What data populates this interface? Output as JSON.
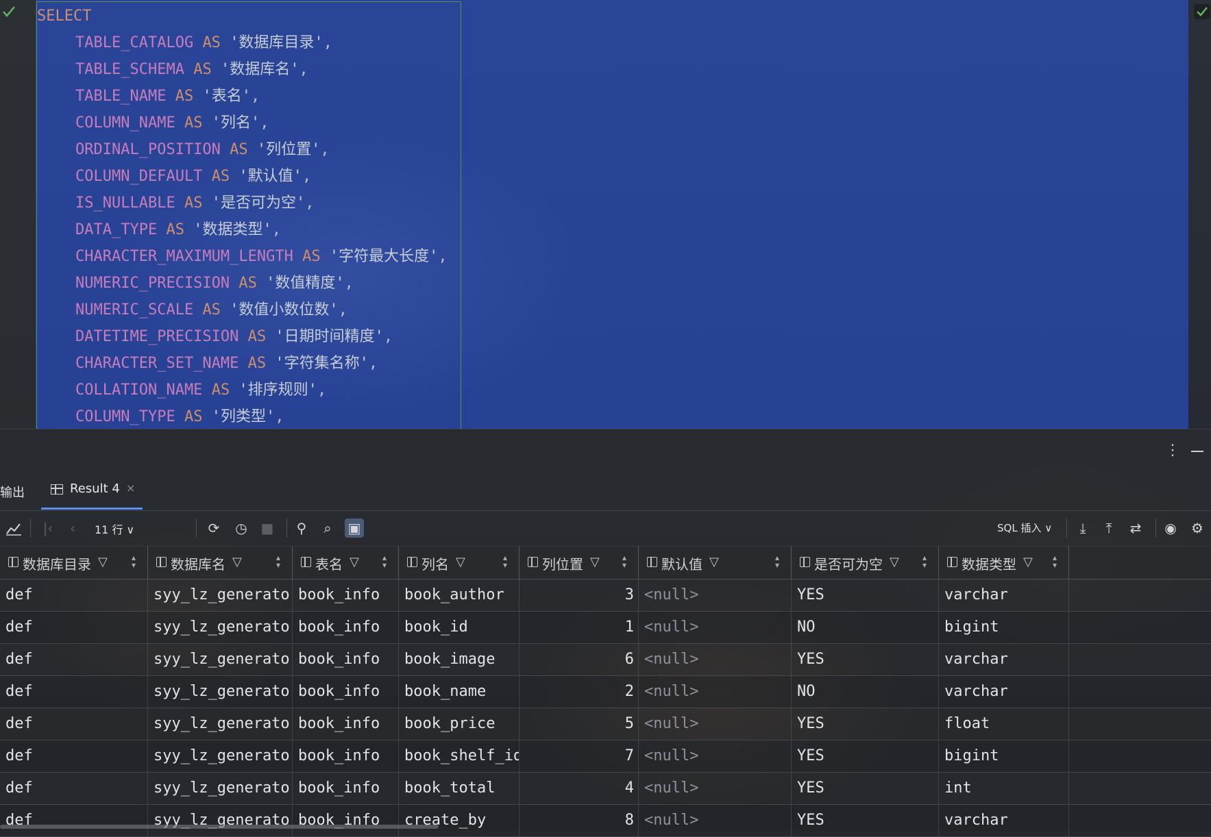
{
  "editor": {
    "sql_lines": [
      {
        "indent": false,
        "column": "",
        "keyword": "SELECT",
        "alias": "",
        "tail": ""
      },
      {
        "indent": true,
        "column": "TABLE_CATALOG",
        "keyword": "AS",
        "alias": "'数据库目录'",
        "tail": ","
      },
      {
        "indent": true,
        "column": "TABLE_SCHEMA",
        "keyword": "AS",
        "alias": "'数据库名'",
        "tail": ","
      },
      {
        "indent": true,
        "column": "TABLE_NAME",
        "keyword": "AS",
        "alias": "'表名'",
        "tail": ","
      },
      {
        "indent": true,
        "column": "COLUMN_NAME",
        "keyword": "AS",
        "alias": "'列名'",
        "tail": ","
      },
      {
        "indent": true,
        "column": "ORDINAL_POSITION",
        "keyword": "AS",
        "alias": "'列位置'",
        "tail": ","
      },
      {
        "indent": true,
        "column": "COLUMN_DEFAULT",
        "keyword": "AS",
        "alias": "'默认值'",
        "tail": ","
      },
      {
        "indent": true,
        "column": "IS_NULLABLE",
        "keyword": "AS",
        "alias": "'是否可为空'",
        "tail": ","
      },
      {
        "indent": true,
        "column": "DATA_TYPE",
        "keyword": "AS",
        "alias": "'数据类型'",
        "tail": ","
      },
      {
        "indent": true,
        "column": "CHARACTER_MAXIMUM_LENGTH",
        "keyword": "AS",
        "alias": "'字符最大长度'",
        "tail": ","
      },
      {
        "indent": true,
        "column": "NUMERIC_PRECISION",
        "keyword": "AS",
        "alias": "'数值精度'",
        "tail": ","
      },
      {
        "indent": true,
        "column": "NUMERIC_SCALE",
        "keyword": "AS",
        "alias": "'数值小数位数'",
        "tail": ","
      },
      {
        "indent": true,
        "column": "DATETIME_PRECISION",
        "keyword": "AS",
        "alias": "'日期时间精度'",
        "tail": ","
      },
      {
        "indent": true,
        "column": "CHARACTER_SET_NAME",
        "keyword": "AS",
        "alias": "'字符集名称'",
        "tail": ","
      },
      {
        "indent": true,
        "column": "COLLATION_NAME",
        "keyword": "AS",
        "alias": "'排序规则'",
        "tail": ","
      },
      {
        "indent": true,
        "column": "COLUMN_TYPE",
        "keyword": "AS",
        "alias": "'列类型'",
        "tail": ","
      }
    ]
  },
  "tool_window": {
    "tabs": {
      "output": "输出",
      "result": "Result 4",
      "close": "×"
    },
    "toolbar": {
      "row_count": "11 行 ∨",
      "sql_insert": "SQL 插入 ∨"
    },
    "columns": [
      "数据库目录",
      "数据库名",
      "表名",
      "列名",
      "列位置",
      "默认值",
      "是否可为空",
      "数据类型"
    ],
    "rows": [
      [
        "def",
        "syy_lz_generator",
        "book_info",
        "book_author",
        "3",
        "<null>",
        "YES",
        "varchar"
      ],
      [
        "def",
        "syy_lz_generator",
        "book_info",
        "book_id",
        "1",
        "<null>",
        "NO",
        "bigint"
      ],
      [
        "def",
        "syy_lz_generator",
        "book_info",
        "book_image",
        "6",
        "<null>",
        "YES",
        "varchar"
      ],
      [
        "def",
        "syy_lz_generator",
        "book_info",
        "book_name",
        "2",
        "<null>",
        "NO",
        "varchar"
      ],
      [
        "def",
        "syy_lz_generator",
        "book_info",
        "book_price",
        "5",
        "<null>",
        "YES",
        "float"
      ],
      [
        "def",
        "syy_lz_generator",
        "book_info",
        "book_shelf_id",
        "7",
        "<null>",
        "YES",
        "bigint"
      ],
      [
        "def",
        "syy_lz_generator",
        "book_info",
        "book_total",
        "4",
        "<null>",
        "YES",
        "int"
      ],
      [
        "def",
        "syy_lz_generator",
        "book_info",
        "create_by",
        "8",
        "<null>",
        "YES",
        "varchar"
      ]
    ]
  },
  "colors": {
    "selection": "#2142aa",
    "keyword": "#cf8e6d",
    "column": "#c77dbb",
    "accent": "#5a8ef0",
    "check": "#5fb85a"
  }
}
